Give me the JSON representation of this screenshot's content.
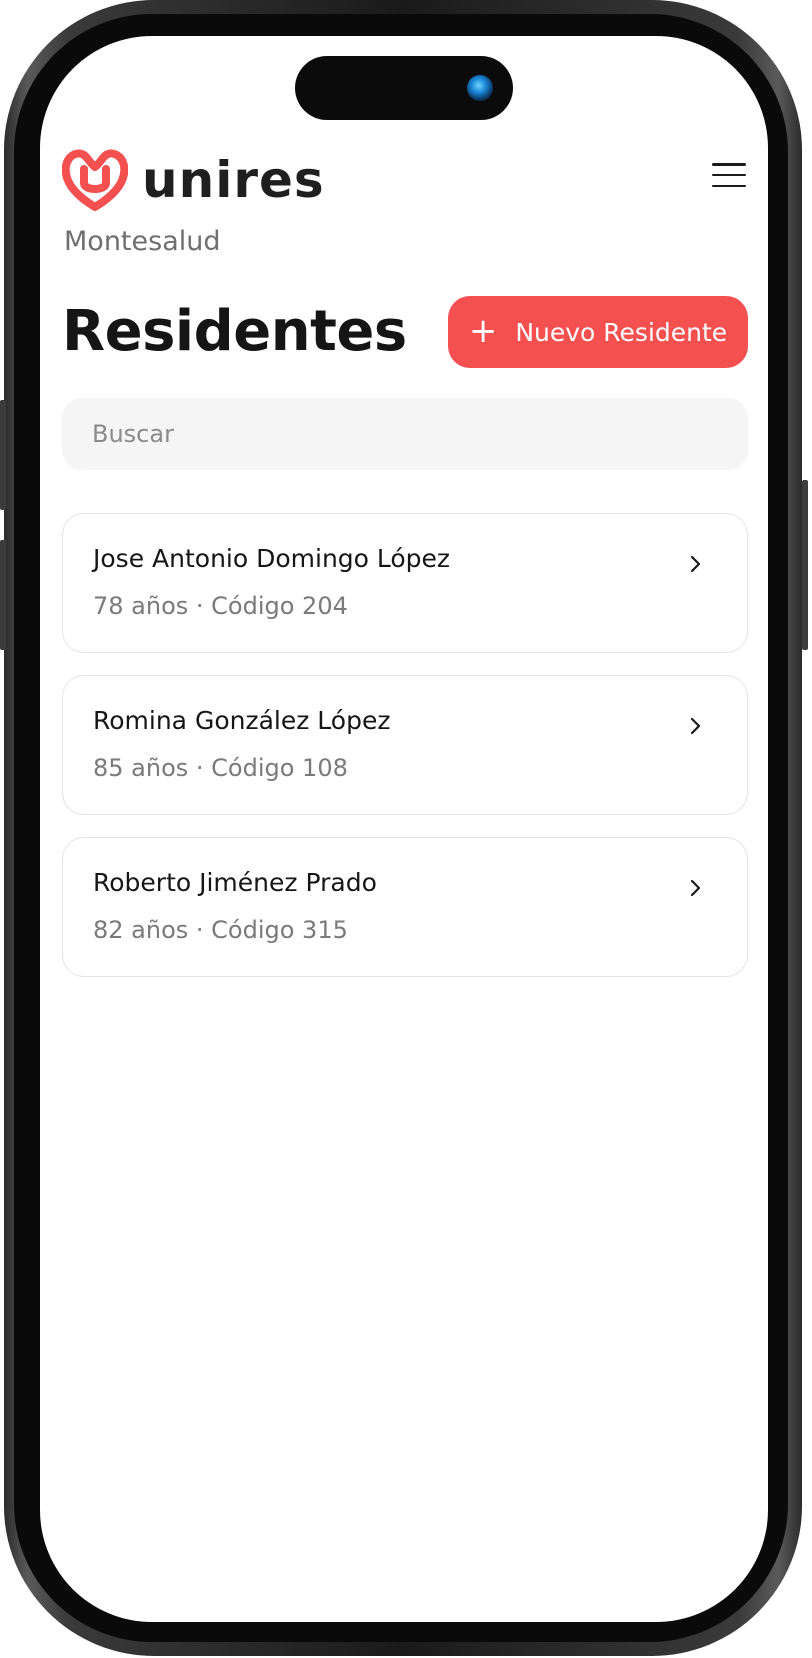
{
  "app": {
    "brand": "unires",
    "organization": "Montesalud",
    "brand_color": "#f45050"
  },
  "header": {
    "menu_icon": "hamburger-menu-icon"
  },
  "page": {
    "title": "Residentes",
    "new_button_label": "Nuevo Residente",
    "new_button_icon": "plus-icon"
  },
  "search": {
    "placeholder": "Buscar",
    "value": ""
  },
  "residents": [
    {
      "name": "Jose Antonio Domingo López",
      "meta": "78 años · Código 204"
    },
    {
      "name": "Romina González López",
      "meta": "85 años · Código 108"
    },
    {
      "name": "Roberto Jiménez Prado",
      "meta": "82 años · Código 315"
    }
  ]
}
